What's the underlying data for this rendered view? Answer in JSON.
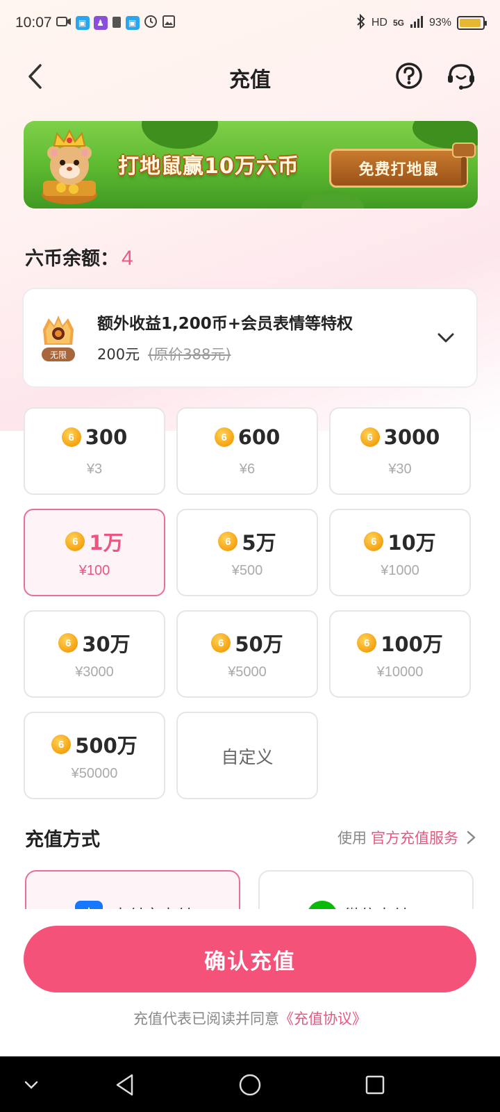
{
  "status_bar": {
    "time": "10:07",
    "network": "HD",
    "signal": "5G",
    "battery_percent_text": "93%",
    "battery_level": 0.93
  },
  "header": {
    "title": "充值",
    "back_icon": "back-arrow-icon",
    "help_icon": "help-circle-icon",
    "service_icon": "customer-service-icon"
  },
  "banner": {
    "headline": "打地鼠赢10万六币",
    "cta_label": "免费打地鼠"
  },
  "balance": {
    "label": "六币余额：",
    "value": "4"
  },
  "vip": {
    "badge_text": "无限",
    "title": "额外收益1,200币+会员表情等特权",
    "price": "200元",
    "original_price": "(原价388元)"
  },
  "coin_glyph": "6",
  "packages": [
    {
      "amount": "300",
      "price": "¥3",
      "selected": false
    },
    {
      "amount": "600",
      "price": "¥6",
      "selected": false
    },
    {
      "amount": "3000",
      "price": "¥30",
      "selected": false
    },
    {
      "amount": "1万",
      "price": "¥100",
      "selected": true
    },
    {
      "amount": "5万",
      "price": "¥500",
      "selected": false
    },
    {
      "amount": "10万",
      "price": "¥1000",
      "selected": false
    },
    {
      "amount": "30万",
      "price": "¥3000",
      "selected": false
    },
    {
      "amount": "50万",
      "price": "¥5000",
      "selected": false
    },
    {
      "amount": "100万",
      "price": "¥10000",
      "selected": false
    },
    {
      "amount": "500万",
      "price": "¥50000",
      "selected": false
    }
  ],
  "custom_package_label": "自定义",
  "payment": {
    "title": "充值方式",
    "link_prefix": "使用",
    "link_label": "官方充值服务",
    "options": [
      {
        "label": "支付宝支付",
        "icon": "alipay-icon",
        "color": "#1677ff",
        "selected": true
      },
      {
        "label": "微信支付",
        "icon": "wechat-pay-icon",
        "color": "#09bb07",
        "selected": false
      }
    ]
  },
  "confirm_label": "确认充值",
  "agreement": {
    "prefix": "充值代表已阅读并同意",
    "link": "《充值协议》"
  },
  "colors": {
    "accent": "#f5527a",
    "accent_text": "#e8577e",
    "coin": "#f5a211"
  }
}
